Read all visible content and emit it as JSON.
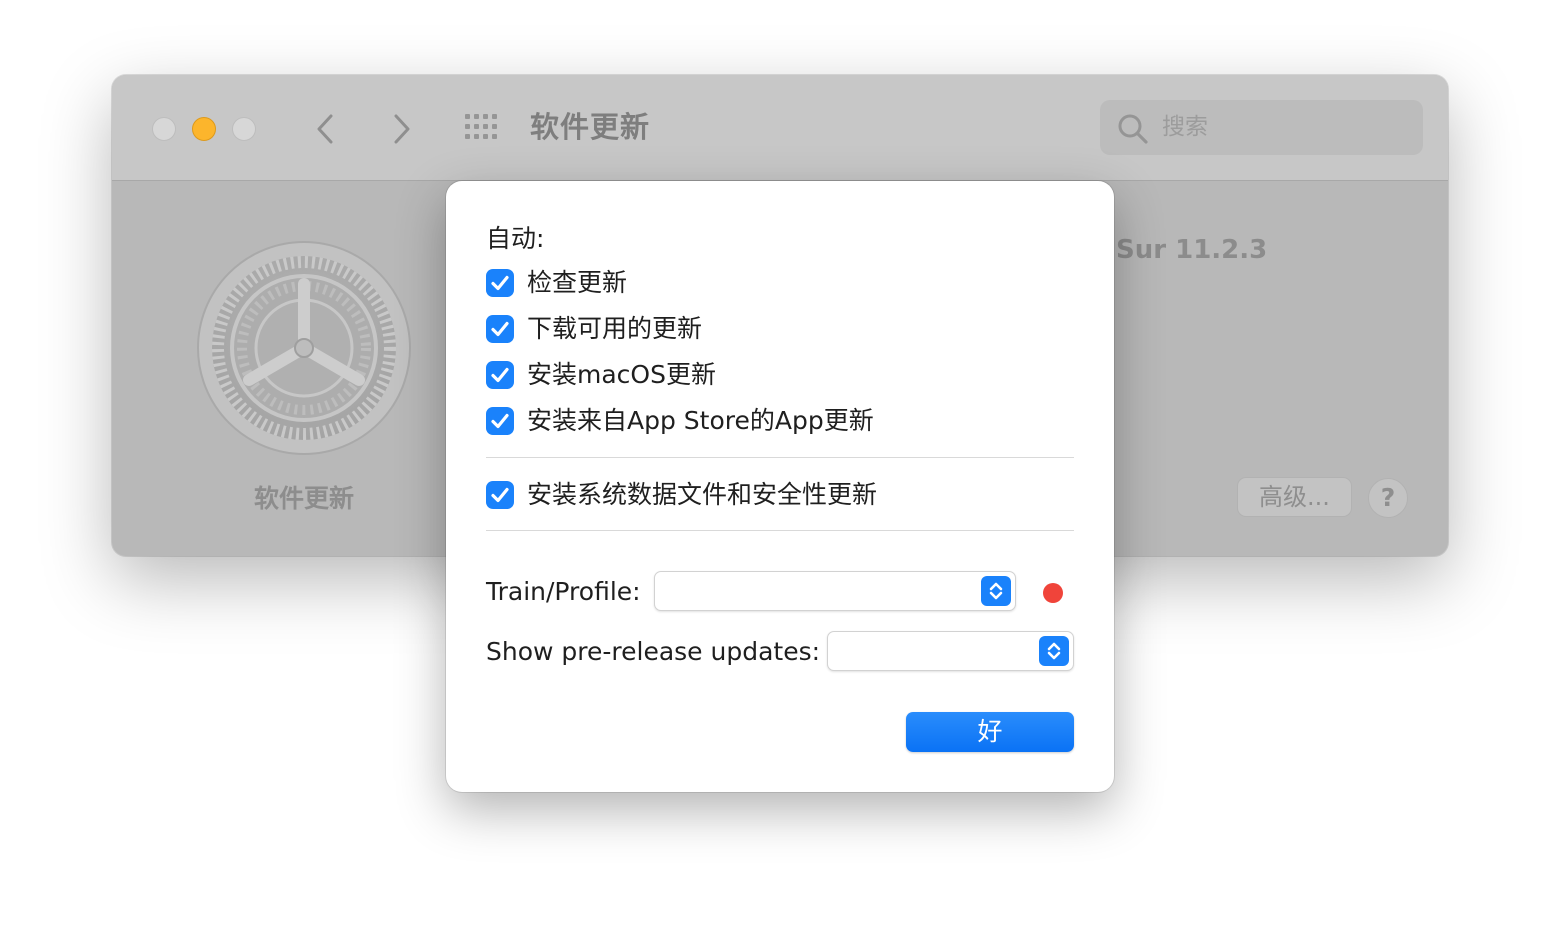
{
  "window": {
    "title": "软件更新",
    "search_placeholder": "搜索",
    "sidebar_label": "软件更新",
    "version_text": "Sur 11.2.3",
    "advanced_button": "高级...",
    "help_button": "?"
  },
  "sheet": {
    "section_label": "自动:",
    "checkboxes": [
      {
        "label": "检查更新",
        "checked": true
      },
      {
        "label": "下载可用的更新",
        "checked": true
      },
      {
        "label": "安装macOS更新",
        "checked": true
      },
      {
        "label": "安装来自App Store的App更新",
        "checked": true
      },
      {
        "label": "安装系统数据文件和安全性更新",
        "checked": true
      }
    ],
    "train_label": "Train/Profile:",
    "train_value": "",
    "prerelease_label": "Show pre-release updates:",
    "prerelease_value": "",
    "ok_button": "好"
  },
  "colors": {
    "accent": "#1a82fb",
    "status_dot": "#f0443a",
    "traffic_minimize": "#fcb52c"
  },
  "icons": {
    "back": "chevron-left-icon",
    "forward": "chevron-right-icon",
    "show_all": "grid-icon",
    "search": "search-icon",
    "app": "gear-icon"
  }
}
